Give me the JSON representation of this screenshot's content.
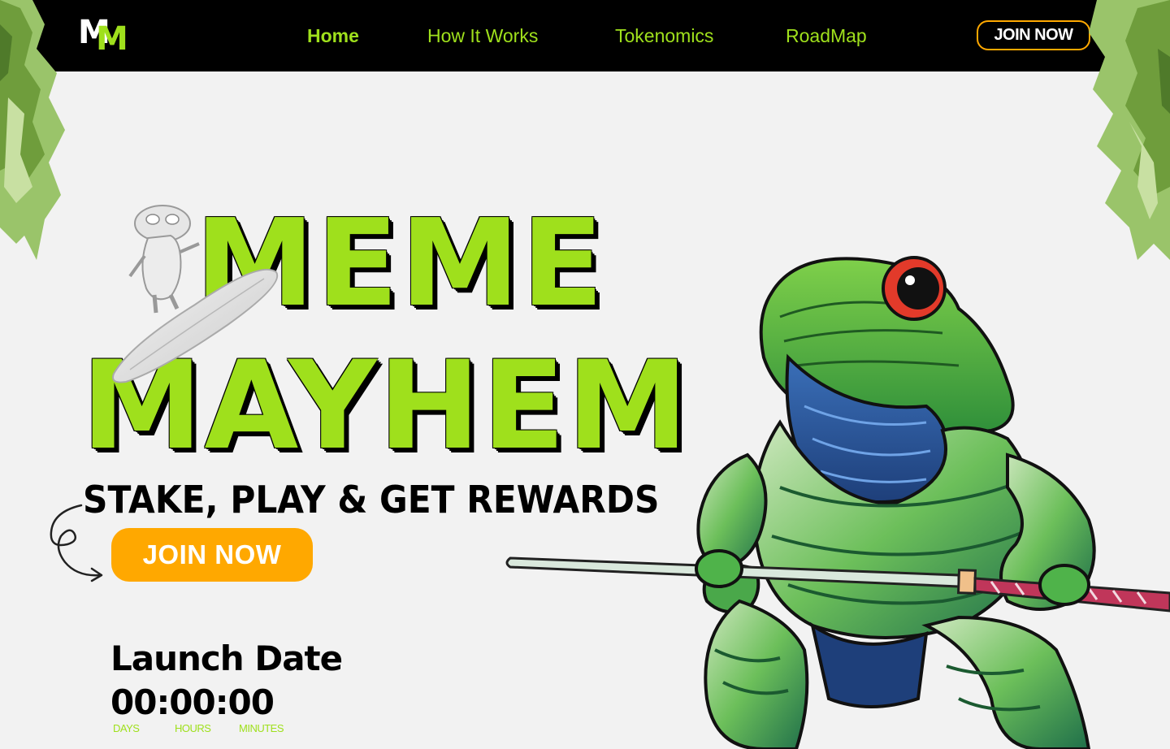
{
  "nav": {
    "logo_letter_1": "M",
    "logo_letter_2": "M",
    "links": [
      {
        "label": "Home",
        "active": true
      },
      {
        "label": "How It Works",
        "active": false
      },
      {
        "label": "Tokenomics",
        "active": false
      },
      {
        "label": "RoadMap",
        "active": false
      }
    ],
    "cta_label": "JOIN NOW"
  },
  "hero": {
    "title_line_1": "MEME",
    "title_line_2": "MAYHEM",
    "tagline": "STAKE, PLAY & GET REWARDS",
    "cta_label": "JOIN NOW"
  },
  "launch": {
    "label": "Launch Date",
    "countdown": "00:00:00",
    "units": [
      "DAYS",
      "HOURS",
      "MINUTES"
    ]
  },
  "colors": {
    "accent_green": "#9fe01c",
    "accent_orange": "#ffa800",
    "nav_bg": "#000000",
    "page_bg": "#f2f2f2"
  },
  "icons": {
    "leaves_left": "leaves-decoration-icon",
    "leaves_right": "leaves-decoration-icon",
    "squiggle": "curly-arrow-icon",
    "frog": "samurai-frog-illustration",
    "surfer": "surfing-frog-illustration"
  }
}
